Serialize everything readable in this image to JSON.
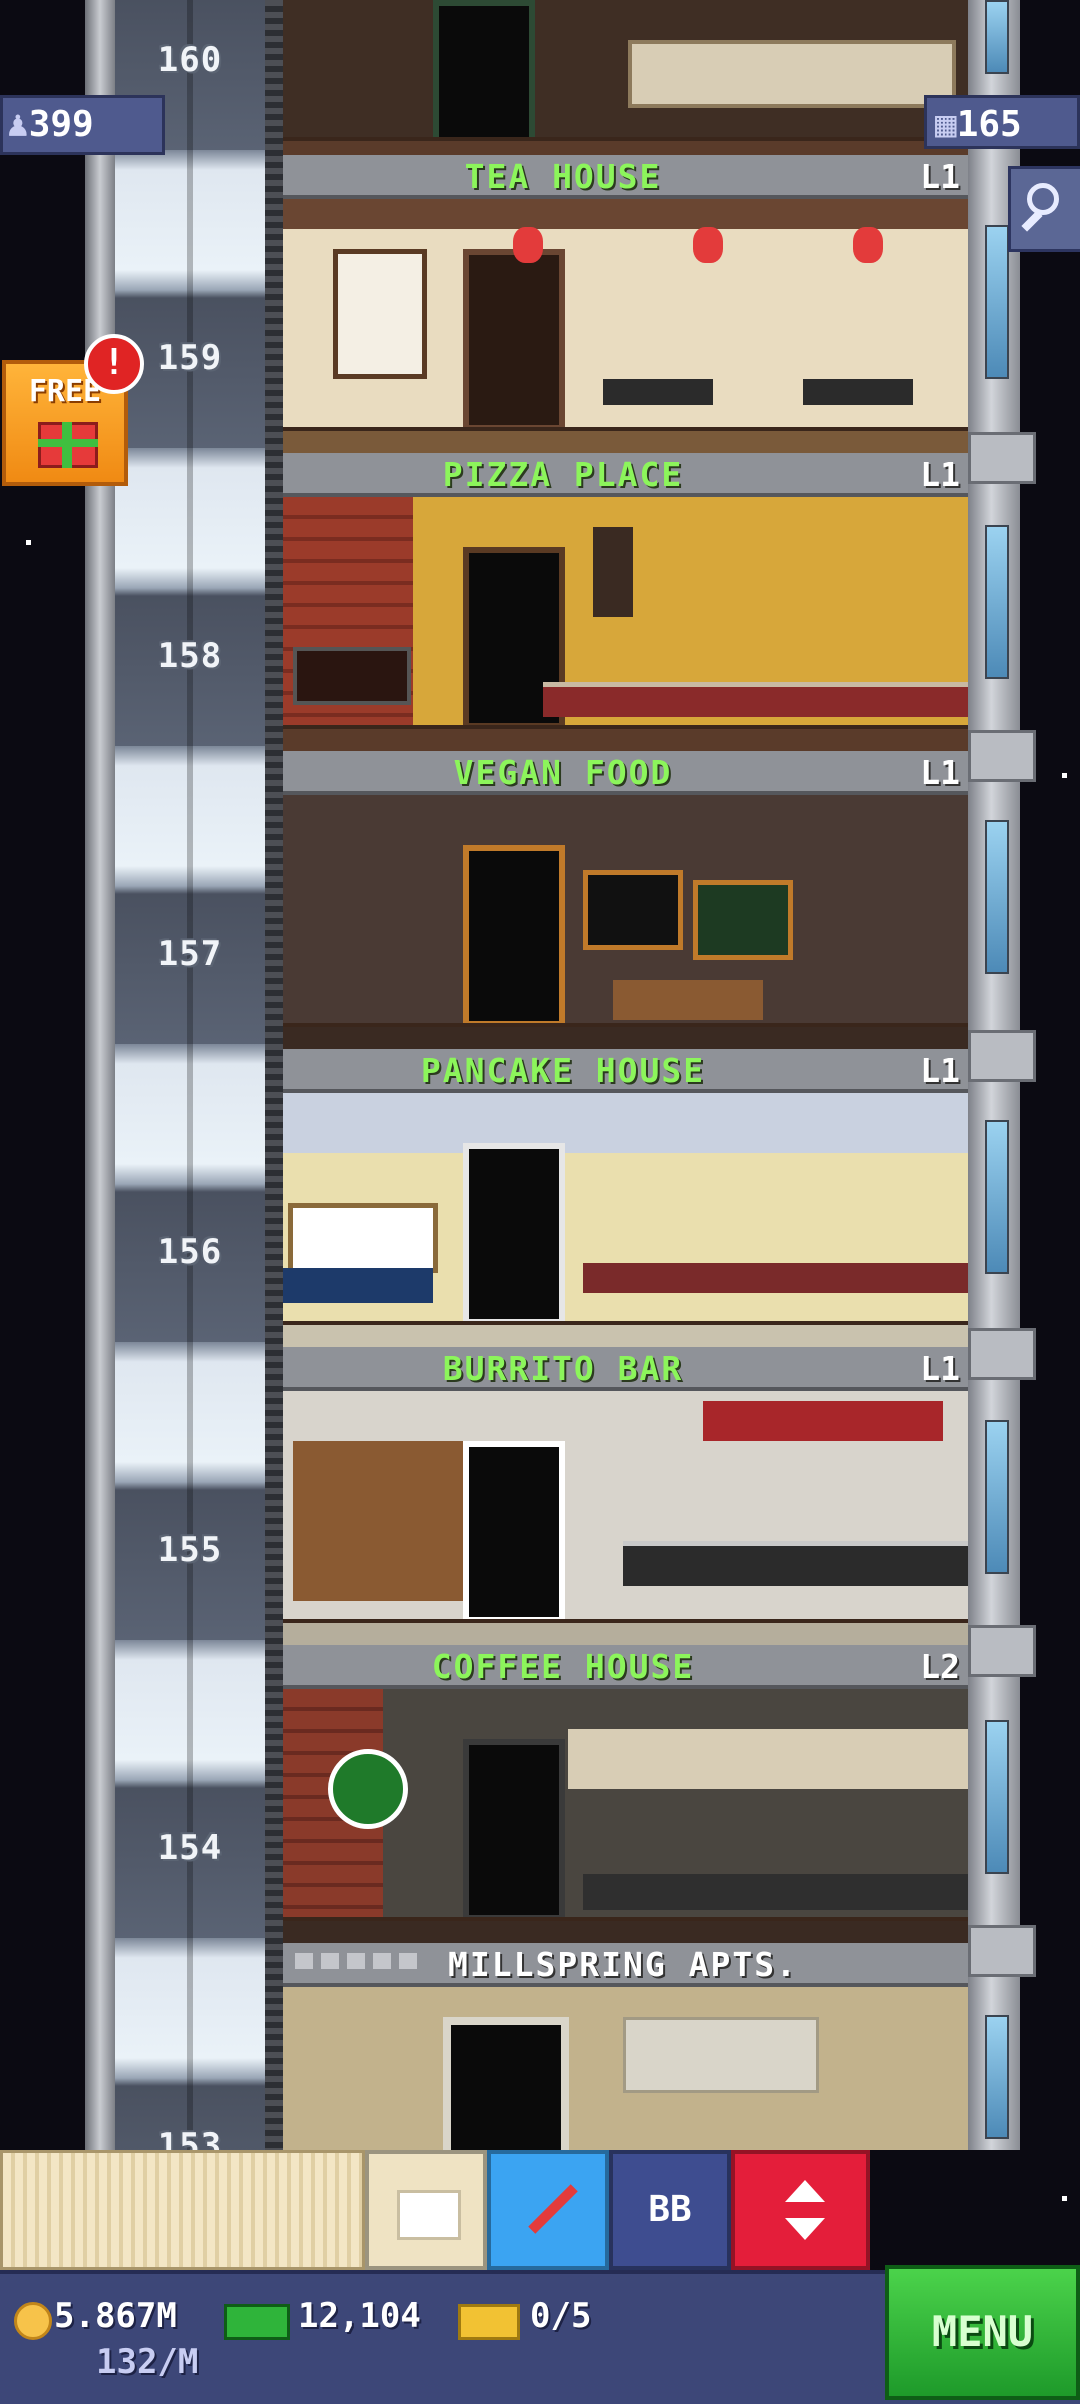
{
  "hud_top": {
    "population": "399",
    "floors": "165"
  },
  "gift": {
    "label": "FREE",
    "alert": "!"
  },
  "elevator_floor_numbers": [
    "160",
    "159",
    "158",
    "157",
    "156",
    "155",
    "154",
    "153"
  ],
  "floors": [
    {
      "name": "TEA HOUSE",
      "level": "L1"
    },
    {
      "name": "PIZZA PLACE",
      "level": "L1"
    },
    {
      "name": "VEGAN FOOD",
      "level": "L1"
    },
    {
      "name": "PANCAKE HOUSE",
      "level": "L1"
    },
    {
      "name": "BURRITO BAR",
      "level": "L1"
    },
    {
      "name": "COFFEE HOUSE",
      "level": "L2"
    },
    {
      "name": "MILLSPRING APTS.",
      "level": ""
    }
  ],
  "toolbar": {
    "bb_label": "BB"
  },
  "hud_bottom": {
    "coins": "5.867M",
    "coins_rate": "132/M",
    "bux": "12,104",
    "tickets": "0/5",
    "menu_label": "MENU"
  },
  "colors": {
    "floor_label": "#8cf55b",
    "menu": "#1e9a2a",
    "hud": "#3d4778",
    "alert": "#e02424"
  }
}
